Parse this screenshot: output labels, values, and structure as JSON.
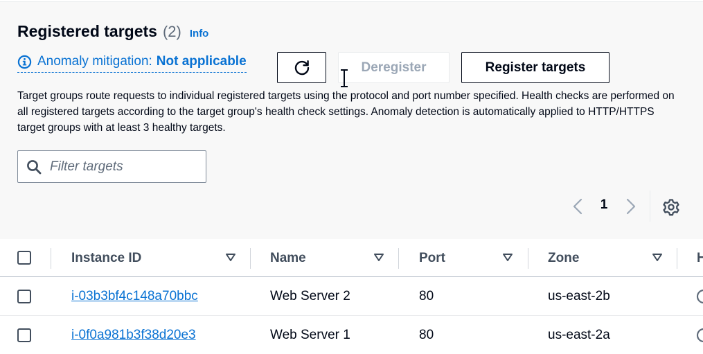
{
  "header": {
    "title": "Registered targets",
    "count": "(2)",
    "info_label": "Info"
  },
  "anomaly": {
    "label": "Anomaly mitigation:",
    "value": "Not applicable"
  },
  "toolbar": {
    "refresh_icon": "refresh-icon",
    "deregister_label": "Deregister",
    "register_label": "Register targets"
  },
  "description": "Target groups route requests to individual registered targets using the protocol and port number specified. Health checks are performed on all registered targets according to the target group's health check settings. Anomaly detection is automatically applied to HTTP/HTTPS target groups with at least 3 healthy targets.",
  "filter": {
    "placeholder": "Filter targets",
    "value": ""
  },
  "pagination": {
    "current_page": "1"
  },
  "table": {
    "columns": [
      "Instance ID",
      "Name",
      "Port",
      "Zone",
      "H"
    ],
    "rows": [
      {
        "instance_id": "i-03b3bf4c148a70bbc",
        "name": "Web Server 2",
        "port": "80",
        "zone": "us-east-2b"
      },
      {
        "instance_id": "i-0f0a981b3f38d20e3",
        "name": "Web Server 1",
        "port": "80",
        "zone": "us-east-2a"
      }
    ]
  },
  "colors": {
    "link": "#0972d3",
    "text": "#000716",
    "disabled": "#9ba7b6",
    "panel_bg": "#f8f8f8"
  }
}
